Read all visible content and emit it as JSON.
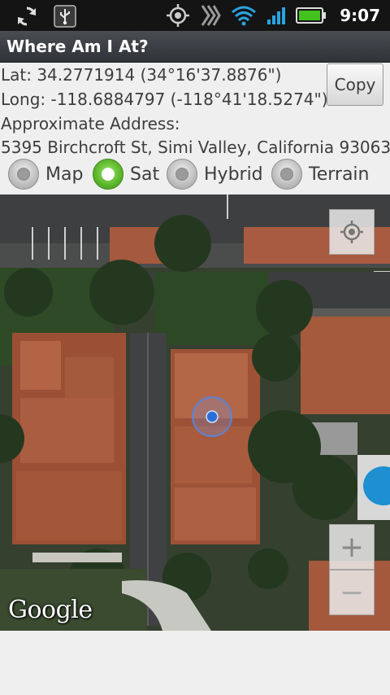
{
  "status_bar": {
    "time": "9:07",
    "icons": [
      "sync-icon",
      "usb-icon",
      "gps-icon",
      "signal-icon",
      "wifi-icon",
      "cell-signal-icon",
      "battery-icon"
    ]
  },
  "app": {
    "title": "Where Am I At?"
  },
  "location": {
    "lat_line": "Lat: 34.2771914 (34°16'37.8876\")",
    "long_line": "Long: -118.6884797 (-118°41'18.5274\")",
    "address_label": "Approximate Address:",
    "address": "5395 Birchcroft St, Simi Valley, California 93063"
  },
  "copy_button": {
    "label": "Copy"
  },
  "map_types": [
    {
      "label": "Map",
      "checked": false
    },
    {
      "label": "Sat",
      "checked": true
    },
    {
      "label": "Hybrid",
      "checked": false
    },
    {
      "label": "Terrain",
      "checked": false
    }
  ],
  "map": {
    "attribution": "Google",
    "zoom_in_label": "+",
    "zoom_out_label": "−"
  },
  "colors": {
    "accent_green": "#5bb52a",
    "location_blue": "#2b6fd6"
  }
}
